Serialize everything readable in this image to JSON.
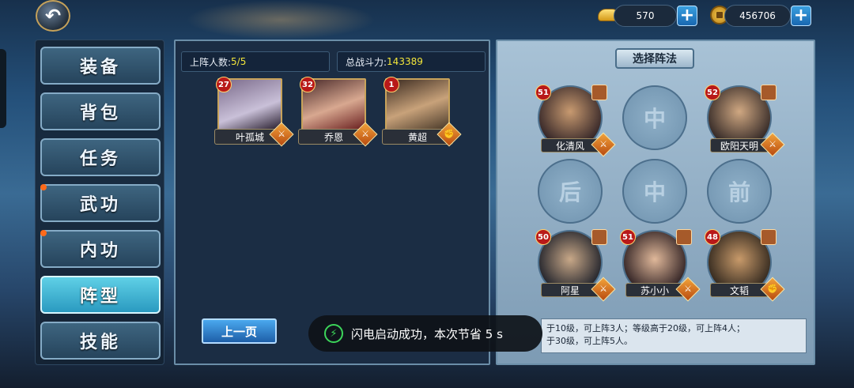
{
  "currency": {
    "gold": "570",
    "coins": "456706",
    "gold_icon": "gold-ingot-icon",
    "coin_icon": "copper-coin-icon",
    "add_icon": "plus-icon"
  },
  "sidebar": {
    "items": [
      {
        "label": "装备",
        "active": false,
        "badge": false
      },
      {
        "label": "背包",
        "active": false,
        "badge": false
      },
      {
        "label": "任务",
        "active": false,
        "badge": false
      },
      {
        "label": "武功",
        "active": false,
        "badge": true
      },
      {
        "label": "内功",
        "active": false,
        "badge": true
      },
      {
        "label": "阵型",
        "active": true,
        "badge": false
      },
      {
        "label": "技能",
        "active": false,
        "badge": false
      }
    ]
  },
  "stats": {
    "members_label": "上阵人数:",
    "members_value": "5/5",
    "power_label": "总战斗力:",
    "power_value": "143389"
  },
  "roster": [
    {
      "name": "叶孤城",
      "level": "27",
      "weapon": "sword"
    },
    {
      "name": "乔恩",
      "level": "32",
      "weapon": "sword"
    },
    {
      "name": "黄超",
      "level": "1",
      "weapon": "fist"
    }
  ],
  "formation": {
    "title": "选择阵法",
    "slots": [
      {
        "type": "hero",
        "name": "化清风",
        "level": "51"
      },
      {
        "type": "empty",
        "label": "中"
      },
      {
        "type": "hero",
        "name": "欧阳天明",
        "level": "52"
      },
      {
        "type": "empty",
        "label": "后"
      },
      {
        "type": "empty",
        "label": "中"
      },
      {
        "type": "empty",
        "label": "前"
      },
      {
        "type": "hero",
        "name": "阿星",
        "level": "50"
      },
      {
        "type": "hero",
        "name": "苏小小",
        "level": "51"
      },
      {
        "type": "hero",
        "name": "文韬",
        "level": "48"
      }
    ]
  },
  "info": {
    "line1": "于10级，可上阵3人；等级高于20级，可上阵4人；",
    "line2": "于30级，可上阵5人。"
  },
  "prev_button": "上一页",
  "toast": {
    "text": "闪电启动成功，本次节省 5 s",
    "icon": "lightning-icon"
  },
  "colors": {
    "accent": "#f2e53a",
    "active_tab": "#5fd0e6",
    "level_badge": "#b81919"
  }
}
